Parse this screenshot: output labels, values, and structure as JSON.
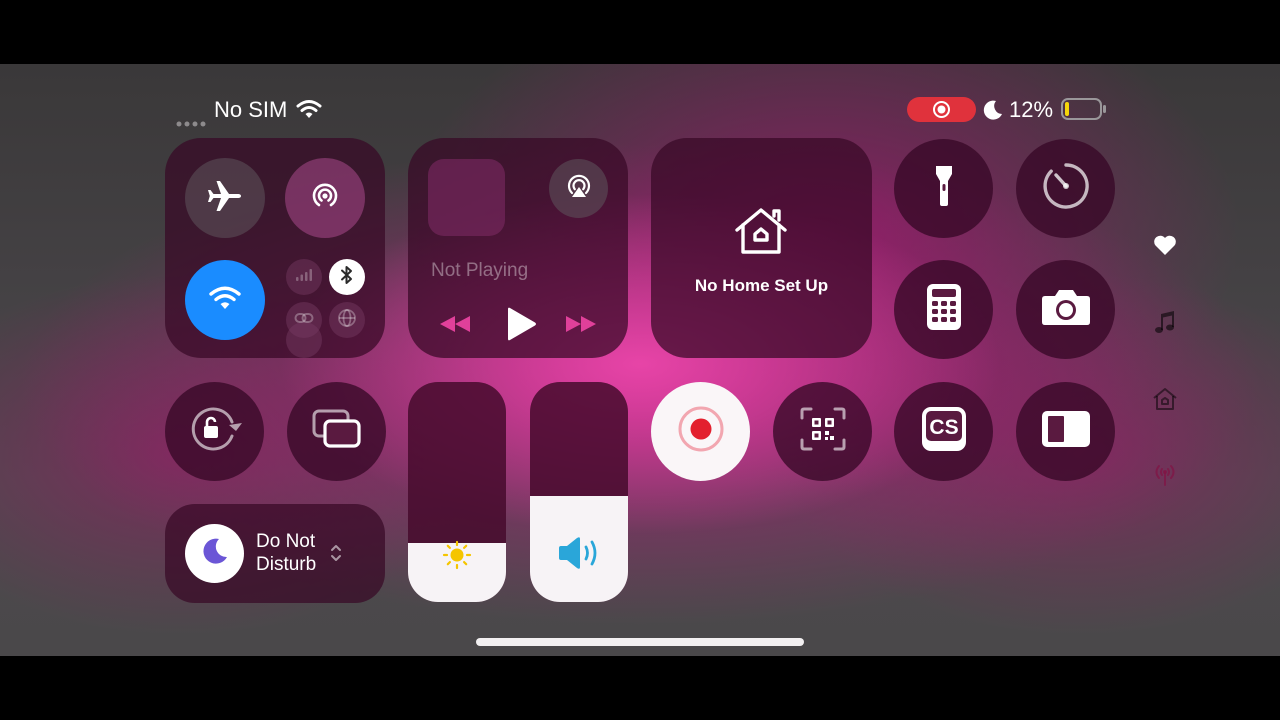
{
  "status_bar": {
    "carrier": "No SIM",
    "battery_percent": "12%",
    "battery_level": 0.12,
    "recording_indicator_color": "#e0323c"
  },
  "media": {
    "now_playing": "Not Playing",
    "accent_color": "#e0409a"
  },
  "home": {
    "label": "No Home Set Up"
  },
  "focus": {
    "line1": "Do Not",
    "line2": "Disturb"
  },
  "sliders": {
    "brightness_level": 0.27,
    "volume_level": 0.48
  },
  "colors": {
    "wifi_active": "#1a8cff",
    "record_dot": "#e3202e",
    "moon_purple": "#6b56d6"
  },
  "icons": {
    "airplane": "airplane-icon",
    "airdrop": "airdrop-icon",
    "wifi": "wifi-icon",
    "cellular": "cellular-icon",
    "bluetooth": "bluetooth-icon",
    "personal_hotspot": "link-icon",
    "vpn": "globe-icon",
    "airplay": "airplay-icon",
    "flashlight": "flashlight-icon",
    "timer": "timer-icon",
    "calculator": "calculator-icon",
    "camera": "camera-icon",
    "rotation_lock": "rotation-lock-icon",
    "screen_mirroring": "screen-mirroring-icon",
    "screen_recording": "record-icon",
    "code_scanner": "qr-code-icon",
    "cs_app": "cs-icon",
    "dark_mode": "dark-mode-icon",
    "favorites": "heart-icon",
    "music": "music-note-icon",
    "home_page": "home-icon",
    "connectivity_page": "antenna-icon"
  }
}
